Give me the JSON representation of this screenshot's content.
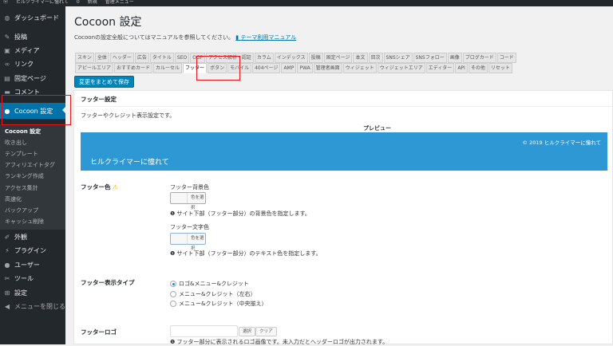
{
  "adminbar": {
    "site": "ヒルクライマーに憧れて",
    "comments": "0",
    "new": "新規",
    "admin_menu": "管理メニュー"
  },
  "sidebar": {
    "items": [
      {
        "label": "ダッシュボード",
        "icon": "dashboard-icon"
      },
      {
        "label": "投稿",
        "icon": "pin-icon"
      },
      {
        "label": "メディア",
        "icon": "media-icon"
      },
      {
        "label": "リンク",
        "icon": "link-icon"
      },
      {
        "label": "固定ページ",
        "icon": "page-icon"
      },
      {
        "label": "コメント",
        "icon": "comment-icon"
      },
      {
        "label": "Cocoon 設定",
        "icon": "circle-icon"
      },
      {
        "label": "外観",
        "icon": "brush-icon"
      },
      {
        "label": "プラグイン",
        "icon": "plugin-icon"
      },
      {
        "label": "ユーザー",
        "icon": "user-icon"
      },
      {
        "label": "ツール",
        "icon": "wrench-icon"
      },
      {
        "label": "設定",
        "icon": "settings-icon"
      },
      {
        "label": "メニューを閉じる",
        "icon": "collapse-icon"
      }
    ],
    "submenu": [
      "Cocoon 設定",
      "吹き出し",
      "テンプレート",
      "アフィリエイトタグ",
      "ランキング作成",
      "アクセス集計",
      "高速化",
      "バックアップ",
      "キャッシュ削除"
    ]
  },
  "page": {
    "title": "Cocoon 設定",
    "intro": "Cocoonの設定全般についてはマニュアルを参照してください。",
    "manual_link": "テーマ利用マニュアル"
  },
  "tabs_row1": [
    "スキン",
    "全体",
    "ヘッダー",
    "広告",
    "タイトル",
    "SEO",
    "OGP",
    "アクセス解析・認証",
    "カラム",
    "インデックス",
    "投稿",
    "固定ページ",
    "本文",
    "目次",
    "SNSシェア",
    "SNSフォロー",
    "画像",
    "ブログカード",
    "コード"
  ],
  "tabs_row2": [
    "アピールエリア",
    "おすすめカード",
    "カルーセル",
    "フッター",
    "ボタン",
    "モバイル",
    "404ページ",
    "AMP",
    "PWA",
    "管理者画面",
    "ウィジェット",
    "ウィジェットエリア",
    "エディター",
    "API",
    "その他",
    "リセット"
  ],
  "active_tab": "フッター",
  "save_label": "変更をまとめて保存",
  "panel": {
    "heading": "フッター設定",
    "desc": "フッターやクレジット表示設定です。",
    "preview_label": "プレビュー",
    "preview_site": "ヒルクライマーに憧れて",
    "preview_credit": "© 2019 ヒルクライマーに憧れて",
    "footer_color": {
      "label": "フッター色",
      "bg_label": "フッター背景色",
      "bg_button": "色を選択",
      "bg_help": "サイト下部（フッター部分）の背景色を指定します。",
      "text_label": "フッター文字色",
      "text_button": "色を選択",
      "text_help": "サイト下部（フッター部分）のテキスト色を指定します。"
    },
    "display_type": {
      "label": "フッター表示タイプ",
      "options": [
        "ロゴ&メニュー&クレジット",
        "メニュー&クレジット（左右）",
        "メニュー&クレジット（中央揃え）"
      ],
      "selected": 0
    },
    "logo": {
      "label": "フッターロゴ",
      "select": "選択",
      "clear": "クリア",
      "help": "フッター部分に表示されるロゴ画像です。未入力だとヘッダーロゴが出力されます。"
    }
  },
  "colors": {
    "accent": "#0073aa",
    "preview": "#2e98d4",
    "highlight": "#e8151b"
  }
}
